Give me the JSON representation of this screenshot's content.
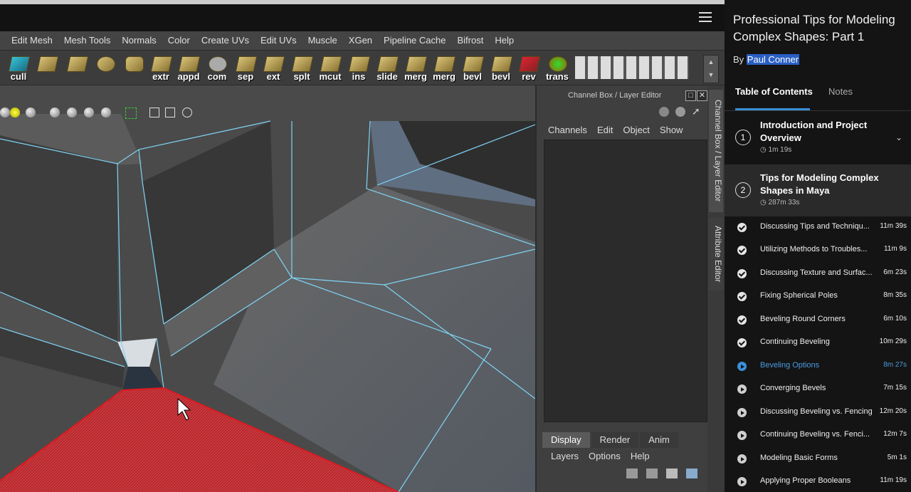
{
  "maya": {
    "menu": [
      "Edit Mesh",
      "Mesh Tools",
      "Normals",
      "Color",
      "Create UVs",
      "Edit UVs",
      "Muscle",
      "XGen",
      "Pipeline Cache",
      "Bifrost",
      "Help"
    ],
    "shelf_labels": [
      "cull",
      "",
      "",
      "",
      "",
      "extr",
      "appd",
      "com",
      "sep",
      "ext",
      "splt",
      "mcut",
      "ins",
      "slide",
      "merg",
      "merg",
      "bevl",
      "bevl",
      "rev",
      "trans"
    ],
    "channel_box": {
      "title": "Channel Box / Layer Editor",
      "menu": [
        "Channels",
        "Edit",
        "Object",
        "Show"
      ],
      "tabs": [
        "Display",
        "Render",
        "Anim"
      ],
      "active_tab": "Display",
      "layer_menu": [
        "Layers",
        "Options",
        "Help"
      ]
    },
    "side_tabs": [
      "Channel Box / Layer Editor",
      "Attribute Editor"
    ]
  },
  "panel": {
    "course_title": "Professional Tips for Modeling Complex Shapes: Part 1",
    "by_label": "By",
    "author": "Paul Conner",
    "tabs": {
      "toc": "Table of Contents",
      "notes": "Notes"
    },
    "modules": [
      {
        "num": "1",
        "title": "Introduction and Project Overview",
        "duration": "1m 19s"
      },
      {
        "num": "2",
        "title": "Tips for Modeling Complex Shapes in Maya",
        "duration": "287m 33s"
      }
    ],
    "clips": [
      {
        "title": "Discussing Tips and Techniqu...",
        "duration": "11m 39s",
        "status": "done"
      },
      {
        "title": "Utilizing Methods to Troubles...",
        "duration": "11m 9s",
        "status": "done"
      },
      {
        "title": "Discussing Texture and Surfac...",
        "duration": "6m 23s",
        "status": "done"
      },
      {
        "title": "Fixing Spherical Poles",
        "duration": "8m 35s",
        "status": "done"
      },
      {
        "title": "Beveling Round Corners",
        "duration": "6m 10s",
        "status": "done"
      },
      {
        "title": "Continuing Beveling",
        "duration": "10m 29s",
        "status": "done"
      },
      {
        "title": "Beveling Options",
        "duration": "8m 27s",
        "status": "current"
      },
      {
        "title": "Converging Bevels",
        "duration": "7m 15s",
        "status": "todo"
      },
      {
        "title": "Discussing Beveling vs. Fencing",
        "duration": "12m 20s",
        "status": "todo"
      },
      {
        "title": "Continuing Beveling vs. Fenci...",
        "duration": "12m 7s",
        "status": "todo"
      },
      {
        "title": "Modeling Basic Forms",
        "duration": "5m 1s",
        "status": "todo"
      },
      {
        "title": "Applying Proper Booleans",
        "duration": "11m 19s",
        "status": "todo"
      }
    ],
    "colors": {
      "accent": "#3b8fd8",
      "selection": "#c8252b",
      "wire": "#7fd4f5"
    }
  }
}
